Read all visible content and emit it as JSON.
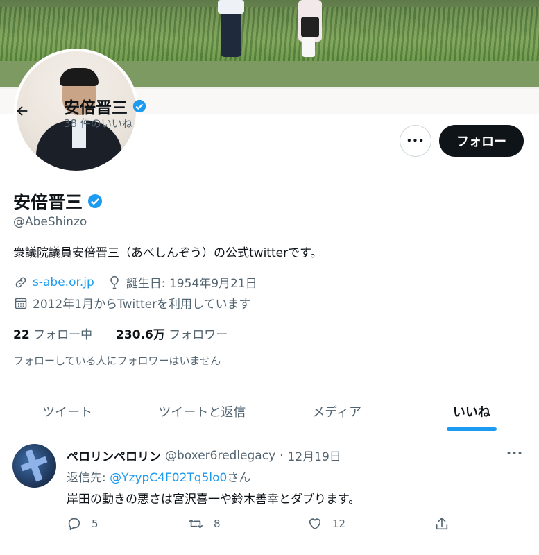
{
  "header": {
    "name": "安倍晋三",
    "likes_count_label": "38 件のいいね"
  },
  "profile": {
    "name": "安倍晋三",
    "handle": "@AbeShinzo",
    "bio": "衆議院議員安倍晋三（あべしんぞう）の公式twitterです。",
    "website": "s-abe.or.jp",
    "birthday": "誕生日: 1954年9月21日",
    "joined": "2012年1月からTwitterを利用しています",
    "following_count": "22",
    "following_label": "フォロー中",
    "followers_count": "230.6万",
    "followers_label": "フォロワー",
    "mutual_note": "フォローしている人にフォロワーはいません",
    "verified": true
  },
  "buttons": {
    "more_label": "•••",
    "follow_label": "フォロー"
  },
  "tabs": [
    {
      "label": "ツイート",
      "active": false
    },
    {
      "label": "ツイートと返信",
      "active": false
    },
    {
      "label": "メディア",
      "active": false
    },
    {
      "label": "いいね",
      "active": true
    }
  ],
  "tweet": {
    "display_name": "ペロリンペロリン",
    "handle": "@boxer6redlegacy",
    "separator": "·",
    "date": "12月19日",
    "reply_prefix": "返信先: ",
    "reply_mention": "@YzypC4F02Tq5lo0",
    "reply_suffix": "さん",
    "text": "岸田の動きの悪さは宮沢喜一や鈴木善幸とダブります。",
    "replies": "5",
    "retweets": "8",
    "likes": "12",
    "more_label": "•••"
  },
  "colors": {
    "accent": "#1d9bf0",
    "text": "#0f1419",
    "muted": "#536471",
    "follow_bg": "#0f1419"
  }
}
